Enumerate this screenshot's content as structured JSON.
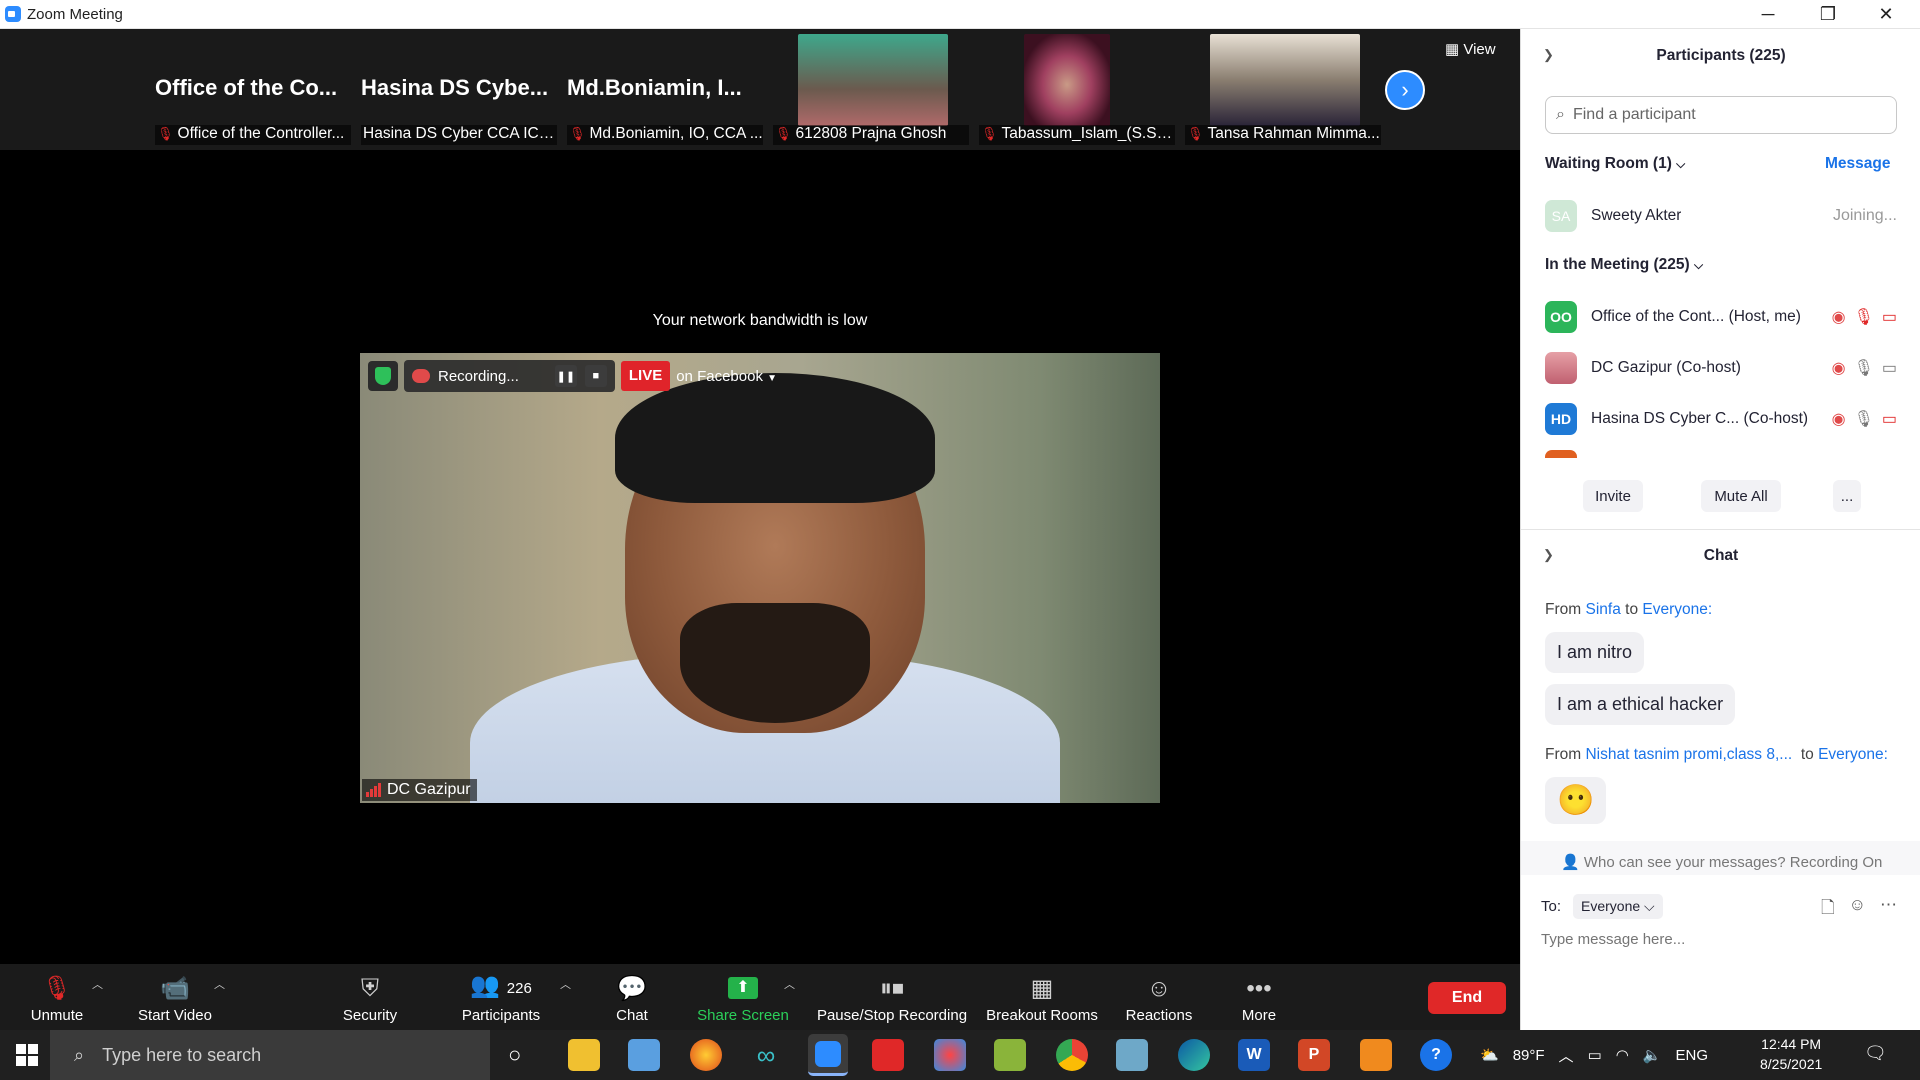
{
  "window": {
    "title": "Zoom Meeting",
    "min": "─",
    "restore": "❐",
    "close": "✕"
  },
  "strip": {
    "tiles": [
      {
        "big": "Office of the Co...",
        "name": "Office of the Controller..."
      },
      {
        "big": "Hasina DS Cybe...",
        "name": "Hasina DS Cyber CCA ICT ..."
      },
      {
        "big": "Md.Boniamin, I...",
        "name": "Md.Boniamin, IO, CCA ..."
      },
      {
        "big": "",
        "name": "612808 Prajna Ghosh"
      },
      {
        "big": "",
        "name": "Tabassum_Islam_(S.S.V..."
      },
      {
        "big": "",
        "name": "Tansa Rahman Mimma..."
      }
    ],
    "view_label": "View"
  },
  "banner": "Your network bandwidth is low",
  "recording": {
    "status": "Recording...",
    "live": "LIVE",
    "destination": "on Facebook"
  },
  "active_speaker": "DC Gazipur",
  "toolbar": {
    "unmute": "Unmute",
    "start_video": "Start Video",
    "security": "Security",
    "participants": "Participants",
    "participants_count": "226",
    "chat": "Chat",
    "share_screen": "Share Screen",
    "pause_stop": "Pause/Stop Recording",
    "breakout": "Breakout Rooms",
    "reactions": "Reactions",
    "more": "More",
    "end": "End"
  },
  "panel": {
    "participants_title": "Participants (225)",
    "search_placeholder": "Find a participant",
    "waiting_room": "Waiting Room (1)",
    "message": "Message",
    "waiting": [
      {
        "initials": "SA",
        "name": "Sweety Akter",
        "status": "Joining..."
      }
    ],
    "in_meeting": "In the Meeting (225)",
    "participants": [
      {
        "initials": "OO",
        "name": "Office of the Cont...",
        "role": "(Host, me)"
      },
      {
        "initials": "",
        "name": "DC Gazipur (Co-host)",
        "role": ""
      },
      {
        "initials": "HD",
        "name": "Hasina DS Cyber C...",
        "role": "(Co-host)"
      }
    ],
    "invite": "Invite",
    "mute_all": "Mute All",
    "more": "..."
  },
  "chat": {
    "title": "Chat",
    "messages": [
      {
        "from": "From",
        "sender": "Sinfa",
        "to": "to",
        "target": "Everyone:",
        "texts": [
          "I am nitro",
          "I am a ethical hacker"
        ]
      },
      {
        "from": "From",
        "sender": "Nishat tasnim promi,class 8,...",
        "to": "to",
        "target": "Everyone:",
        "texts": [
          "😶"
        ]
      }
    ],
    "info": "Who can see your messages? Recording On",
    "to_label": "To:",
    "to_value": "Everyone",
    "input_placeholder": "Type message here..."
  },
  "taskbar": {
    "search_placeholder": "Type here to search",
    "weather": "89°F",
    "lang": "ENG",
    "time": "12:44 PM",
    "date": "8/25/2021"
  }
}
